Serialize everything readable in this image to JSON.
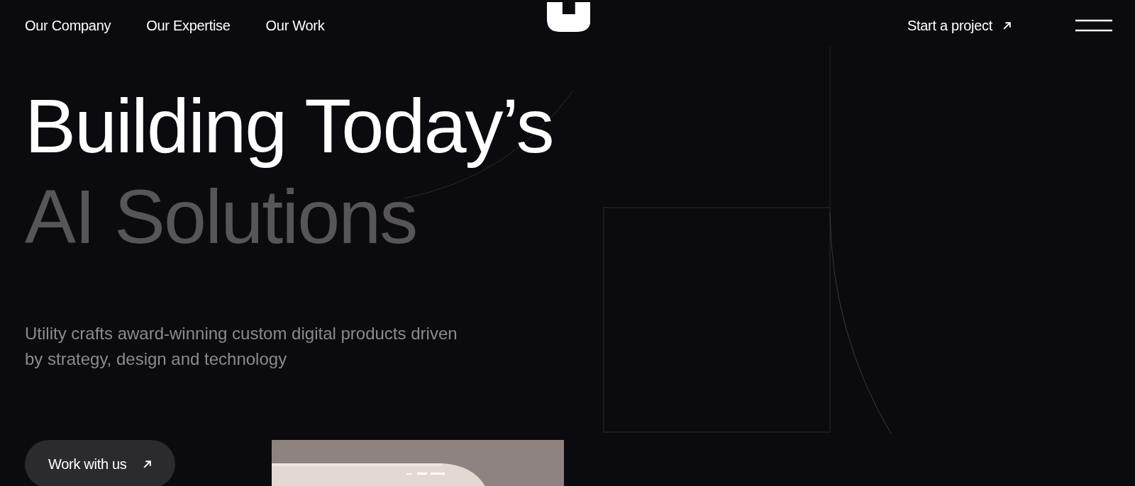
{
  "nav": {
    "links": [
      {
        "label": "Our Company"
      },
      {
        "label": "Our Expertise"
      },
      {
        "label": "Our Work"
      }
    ],
    "cta": {
      "label": "Start a project"
    }
  },
  "hero": {
    "headline": [
      "Building Today’s",
      "AI Solutions"
    ],
    "description": "Utility crafts award-winning custom digital products driven by strategy, design and technology",
    "button": {
      "label": "Work with us"
    },
    "media": {
      "kind": "picture"
    }
  }
}
